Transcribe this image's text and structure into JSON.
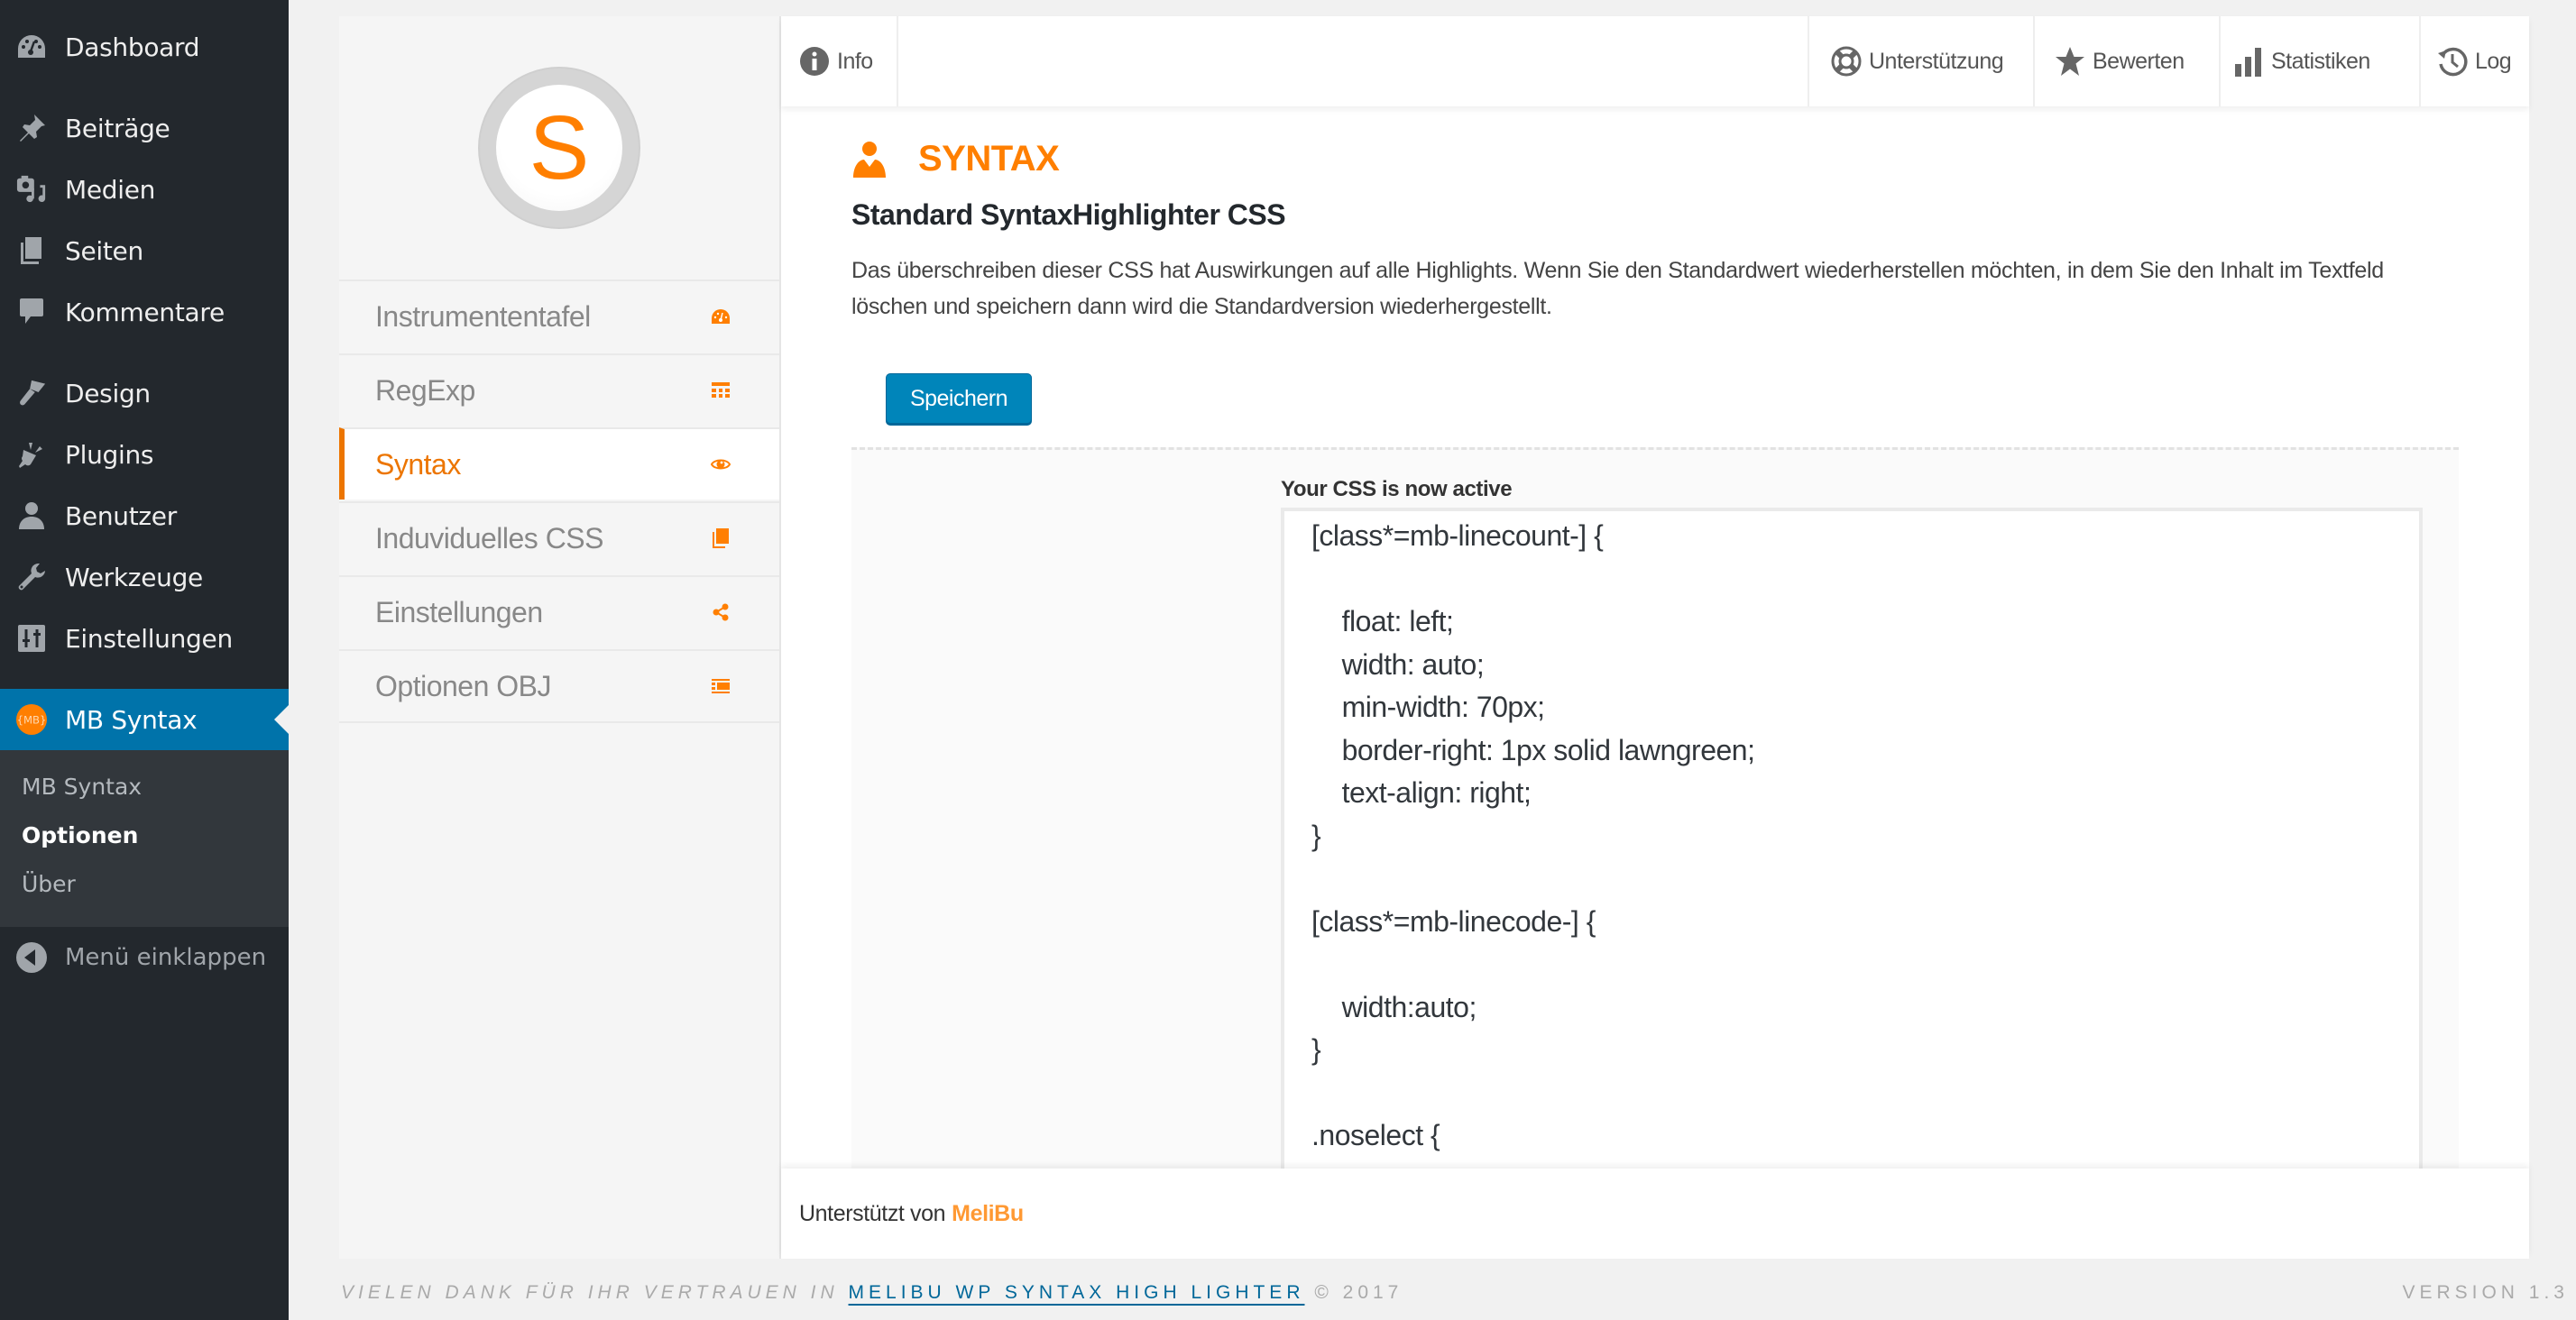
{
  "admin_menu": {
    "items": [
      {
        "label": "Dashboard",
        "icon": "dashboard-icon"
      },
      {
        "label": "Beiträge",
        "icon": "pin-icon"
      },
      {
        "label": "Medien",
        "icon": "media-icon"
      },
      {
        "label": "Seiten",
        "icon": "pages-icon"
      },
      {
        "label": "Kommentare",
        "icon": "comment-icon"
      },
      {
        "label": "Design",
        "icon": "brush-icon"
      },
      {
        "label": "Plugins",
        "icon": "plug-icon"
      },
      {
        "label": "Benutzer",
        "icon": "user-icon"
      },
      {
        "label": "Werkzeuge",
        "icon": "wrench-icon"
      },
      {
        "label": "Einstellungen",
        "icon": "sliders-icon"
      },
      {
        "label": "MB Syntax",
        "icon": "mb-logo-icon",
        "active": true
      }
    ],
    "submenu": [
      {
        "label": "MB Syntax"
      },
      {
        "label": "Optionen",
        "current": true
      },
      {
        "label": "Über"
      }
    ],
    "collapse_label": "Menü einklappen"
  },
  "plugin": {
    "logo_letter": "S",
    "nav": [
      {
        "label": "Instrumententafel",
        "icon": "dashboard-icon"
      },
      {
        "label": "RegExp",
        "icon": "table-icon"
      },
      {
        "label": "Syntax",
        "icon": "eye-icon",
        "active": true
      },
      {
        "label": "Induviduelles CSS",
        "icon": "copy-icon"
      },
      {
        "label": "Einstellungen",
        "icon": "share-icon"
      },
      {
        "label": "Optionen OBJ",
        "icon": "list-icon"
      }
    ],
    "topbar": {
      "info": "Info",
      "right": [
        {
          "label": "Unterstützung",
          "icon": "lifebuoy-icon"
        },
        {
          "label": "Bewerten",
          "icon": "star-icon"
        },
        {
          "label": "Statistiken",
          "icon": "bar-chart-icon"
        },
        {
          "label": "Log",
          "icon": "history-icon"
        }
      ]
    },
    "section": {
      "title": "SYNTAX",
      "subtitle": "Standard SyntaxHighlighter CSS",
      "description": "Das überschreiben dieser CSS hat Auswirkungen auf alle Highlights. Wenn Sie den Standardwert wiederherstellen möchten, in dem Sie den Inhalt im Textfeld löschen und speichern dann wird die Standardversion wiederhergestellt.",
      "save_label": "Speichern",
      "css_label": "Your CSS is now active",
      "css_value": "[class*=mb-linecount-] {\n\n    float: left;\n    width: auto;\n    min-width: 70px;\n    border-right: 1px solid lawngreen;\n    text-align: right;\n}\n\n[class*=mb-linecode-] {\n\n    width:auto;\n}\n\n.noselect {"
    },
    "footer": {
      "prefix": "Unterstützt von",
      "brand": "MeliBu"
    }
  },
  "page_footer": {
    "thanks": "VIELEN DANK FÜR IHR VERTRAUEN IN",
    "link": "MELIBU WP SYNTAX HIGH LIGHTER",
    "copyright": "© 2017",
    "version": "VERSION 1.3"
  },
  "colors": {
    "accent_orange": "#ff7f00",
    "wp_blue": "#0073aa",
    "button_blue": "#0085ba",
    "sidebar_dark": "#23282d"
  }
}
